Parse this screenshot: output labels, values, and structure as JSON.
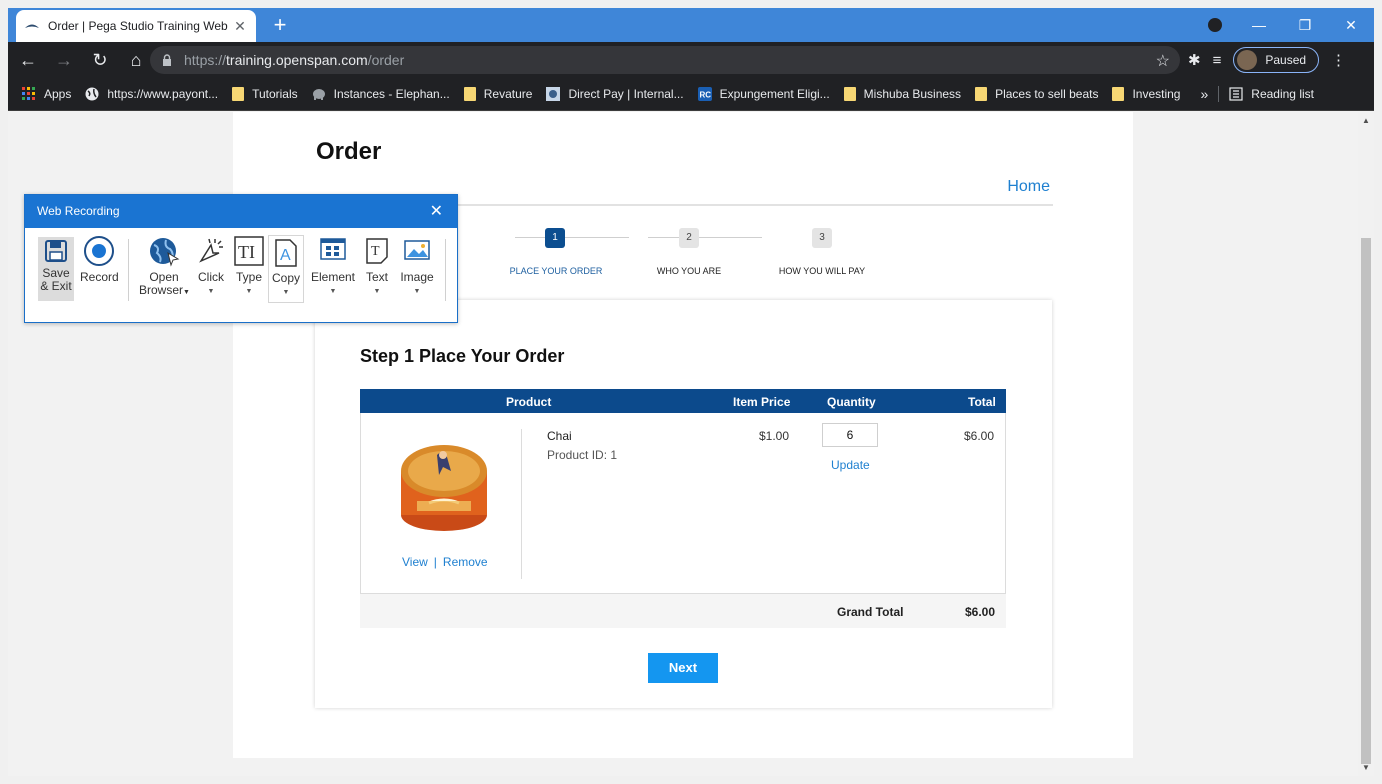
{
  "browser": {
    "tab_title": "Order | Pega Studio Training Web",
    "url_prefix": "https://",
    "url_domain": "training.openspan.com",
    "url_path": "/order",
    "profile_label": "Paused",
    "bookmarks": [
      {
        "label": "Apps",
        "icon": "apps-grid-icon"
      },
      {
        "label": "https://www.payont...",
        "icon": "globe-icon"
      },
      {
        "label": "Tutorials",
        "icon": "folder-icon"
      },
      {
        "label": "Instances - Elephan...",
        "icon": "elephant-icon"
      },
      {
        "label": "Revature",
        "icon": "folder-icon"
      },
      {
        "label": "Direct Pay | Internal...",
        "icon": "irs-icon"
      },
      {
        "label": "Expungement Eligi...",
        "icon": "rc-icon"
      },
      {
        "label": "Mishuba Business",
        "icon": "folder-icon"
      },
      {
        "label": "Places to sell beats",
        "icon": "folder-icon"
      },
      {
        "label": "Investing",
        "icon": "folder-icon"
      }
    ],
    "reading_list": "Reading list",
    "more_bookmarks": "»"
  },
  "page": {
    "title": "Order",
    "home_link": "Home",
    "steps": [
      {
        "number": "1",
        "label": "PLACE YOUR ORDER",
        "active": true
      },
      {
        "number": "2",
        "label": "WHO YOU ARE",
        "active": false
      },
      {
        "number": "3",
        "label": "HOW YOU WILL PAY",
        "active": false
      }
    ],
    "card_title": "Step 1 Place Your Order",
    "table": {
      "headers": {
        "product": "Product",
        "item_price": "Item Price",
        "quantity": "Quantity",
        "total": "Total"
      },
      "row": {
        "name": "Chai",
        "product_id": "Product ID: 1",
        "price": "$1.00",
        "quantity": "6",
        "update": "Update",
        "total": "$6.00",
        "view": "View",
        "separator": "|",
        "remove": "Remove"
      },
      "grand_total_label": "Grand Total",
      "grand_total_value": "$6.00"
    },
    "next_button": "Next"
  },
  "recorder": {
    "title": "Web Recording",
    "buttons": {
      "save_line1": "Save",
      "save_line2": "& Exit",
      "record": "Record",
      "open_line1": "Open",
      "open_line2": "Browser",
      "click": "Click",
      "type": "Type",
      "copy": "Copy",
      "element": "Element",
      "text": "Text",
      "image": "Image"
    }
  },
  "colors": {
    "tabbar": "#3f86d8",
    "chrome_dark": "#202124",
    "table_header": "#0c4a8c",
    "next_button": "#1496f0",
    "link": "#1f80d0",
    "recorder_header": "#1a74d2"
  }
}
